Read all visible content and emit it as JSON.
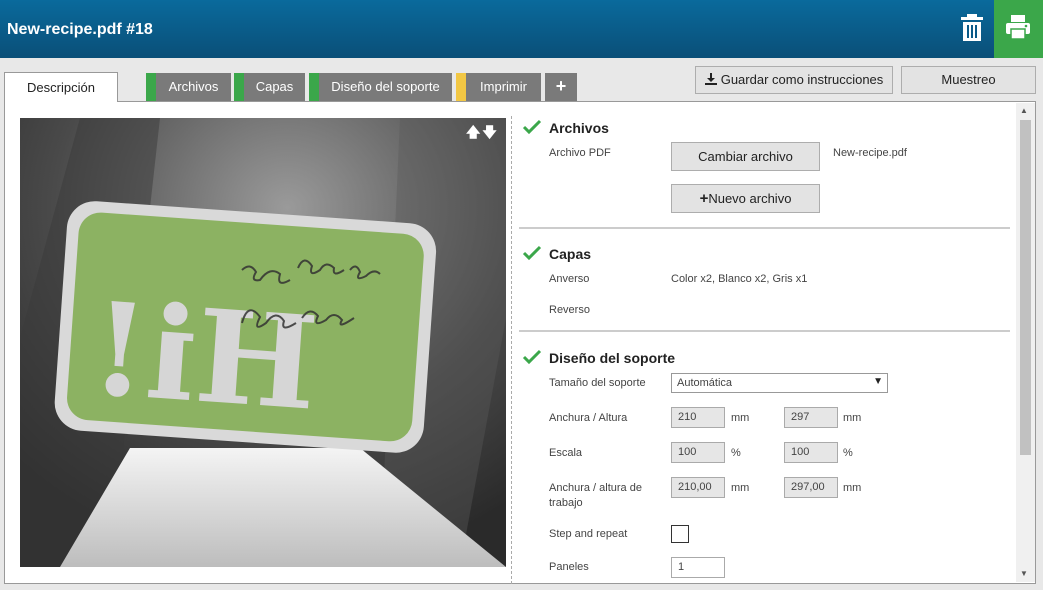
{
  "header": {
    "title": "New-recipe.pdf #18",
    "icons": [
      "trash-icon",
      "printer-icon"
    ],
    "colors": {
      "bar": "#0a5a88",
      "print": "#3ba74a"
    }
  },
  "tabs": [
    {
      "label": "Descripción",
      "active": true
    },
    {
      "label": "Archivos",
      "status_color": "#3ba74a"
    },
    {
      "label": "Capas",
      "status_color": "#3ba74a"
    },
    {
      "label": "Diseño del soporte",
      "status_color": "#3ba74a"
    },
    {
      "label": "Imprimir",
      "status_color": "#f2c744"
    },
    {
      "label": "+"
    }
  ],
  "actions": {
    "save_label": "Guardar como instrucciones",
    "sample_label": "Muestreo"
  },
  "preview": {
    "sign_text": "Hi!",
    "handwriting": "i'm your new shop sign"
  },
  "archivos": {
    "title": "Archivos",
    "pdf_label": "Archivo PDF",
    "change_button": "Cambiar archivo",
    "new_button": "Nuevo archivo",
    "filename": "New-recipe.pdf"
  },
  "capas": {
    "title": "Capas",
    "front_label": "Anverso",
    "front_value": "Color x2, Blanco x2, Gris x1",
    "back_label": "Reverso"
  },
  "diseno": {
    "title": "Diseño del soporte",
    "size_label": "Tamaño del soporte",
    "size_value": "Automática",
    "wh_label": "Anchura / Altura",
    "width": "210",
    "height": "297",
    "unit_mm": "mm",
    "scale_label": "Escala",
    "scale_x": "100",
    "scale_y": "100",
    "unit_pct": "%",
    "work_label_1": "Anchura / altura de",
    "work_label_2": "trabajo",
    "work_width": "210,00",
    "work_height": "297,00",
    "step_label": "Step and repeat",
    "step_checked": false,
    "panels_label": "Paneles",
    "panels_value": "1"
  }
}
